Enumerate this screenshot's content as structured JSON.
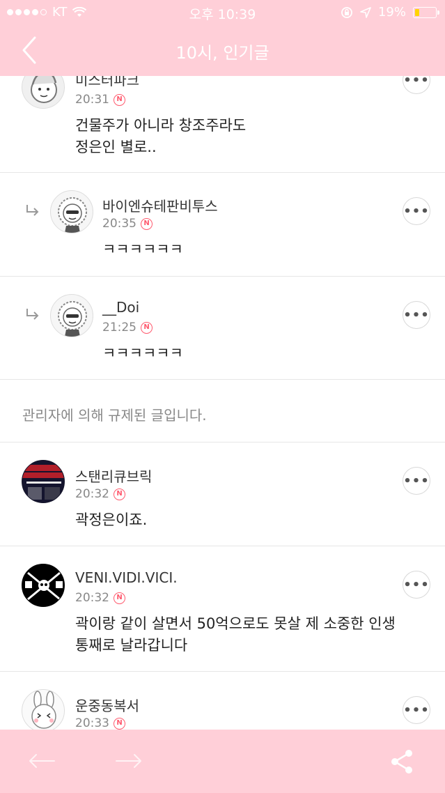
{
  "status": {
    "carrier": "KT",
    "time": "오후 10:39",
    "battery": "19%",
    "battery_fill_fraction": 0.19
  },
  "header": {
    "title": "10시, 인기글",
    "back_icon": "chevron-left-icon"
  },
  "comments": [
    {
      "user": "미스터파크",
      "time": "20:31",
      "badge": "N",
      "lines": [
        "건물주가 아니라 창조주라도",
        "정은인 별로.."
      ],
      "reply": false
    },
    {
      "user": "바이엔슈테판비투스",
      "time": "20:35",
      "badge": "N",
      "lines": [
        "ㅋㅋㅋㅋㅋㅋ"
      ],
      "reply": true
    },
    {
      "user": "__Doi",
      "time": "21:25",
      "badge": "N",
      "lines": [
        "ㅋㅋㅋㅋㅋㅋ"
      ],
      "reply": true
    },
    {
      "user": "스탠리큐브릭",
      "time": "20:32",
      "badge": "N",
      "lines": [
        "곽정은이죠."
      ],
      "reply": false
    },
    {
      "user": "VENI.VIDI.VICI.",
      "time": "20:32",
      "badge": "N",
      "lines": [
        "곽이랑 같이 살면서 50억으로도 못살 제 소중한 인생",
        "통째로 날라갑니다"
      ],
      "reply": false
    },
    {
      "user": "운중동복서",
      "time": "20:33",
      "badge": "N",
      "lines": [],
      "reply": false
    }
  ],
  "moderated_text": "관리자에 의해 규제된 글입니다.",
  "more_label": "•••",
  "toolbar": {
    "back_icon": "arrow-left-icon",
    "forward_icon": "arrow-right-icon",
    "share_icon": "share-icon"
  },
  "colors": {
    "header_bg": "#ffcfd8",
    "badge": "#ff5a6e"
  }
}
